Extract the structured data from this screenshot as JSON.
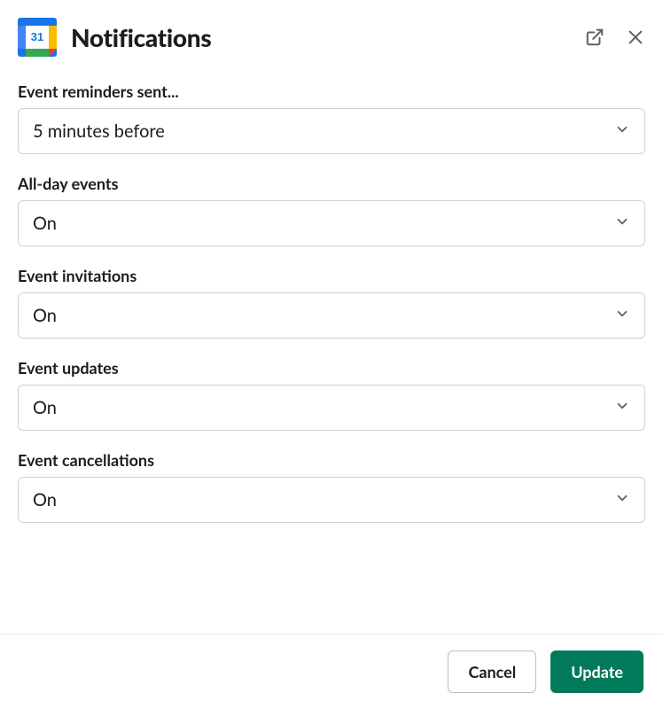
{
  "header": {
    "title": "Notifications",
    "icon_day": "31"
  },
  "fields": {
    "event_reminders": {
      "label": "Event reminders sent...",
      "value": "5 minutes before"
    },
    "all_day_events": {
      "label": "All-day events",
      "value": "On"
    },
    "event_invitations": {
      "label": "Event invitations",
      "value": "On"
    },
    "event_updates": {
      "label": "Event updates",
      "value": "On"
    },
    "event_cancellations": {
      "label": "Event cancellations",
      "value": "On"
    }
  },
  "footer": {
    "cancel_label": "Cancel",
    "update_label": "Update"
  }
}
